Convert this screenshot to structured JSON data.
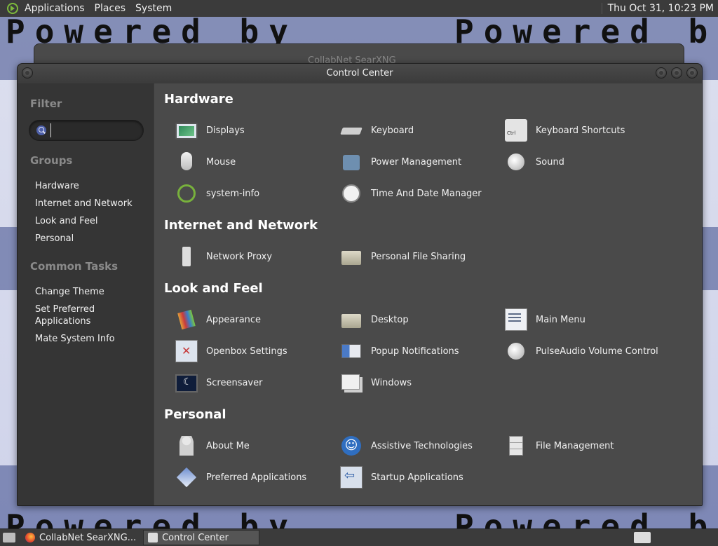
{
  "top_panel": {
    "menus": [
      "Applications",
      "Places",
      "System"
    ],
    "clock": "Thu Oct 31, 10:23 PM"
  },
  "desktop": {
    "wallpaper_text": "Powered by"
  },
  "background_window": {
    "title": "CollabNet SearXNG"
  },
  "window": {
    "title": "Control Center"
  },
  "sidebar": {
    "filter_heading": "Filter",
    "filter_value": "",
    "groups_heading": "Groups",
    "groups": [
      "Hardware",
      "Internet and Network",
      "Look and Feel",
      "Personal"
    ],
    "tasks_heading": "Common Tasks",
    "tasks": [
      "Change Theme",
      "Set Preferred Applications",
      "Mate System Info"
    ]
  },
  "sections": [
    {
      "title": "Hardware",
      "items": [
        {
          "label": "Displays",
          "icon": "display-icon"
        },
        {
          "label": "Keyboard",
          "icon": "keyboard-icon"
        },
        {
          "label": "Keyboard Shortcuts",
          "icon": "keyboard-shortcuts-icon"
        },
        {
          "label": "Mouse",
          "icon": "mouse-icon"
        },
        {
          "label": "Power Management",
          "icon": "power-management-icon"
        },
        {
          "label": "Sound",
          "icon": "sound-icon"
        },
        {
          "label": "system-info",
          "icon": "system-info-icon"
        },
        {
          "label": "Time And Date Manager",
          "icon": "clock-icon"
        }
      ]
    },
    {
      "title": "Internet and Network",
      "items": [
        {
          "label": "Network Proxy",
          "icon": "network-proxy-icon"
        },
        {
          "label": "Personal File Sharing",
          "icon": "folder-share-icon"
        }
      ]
    },
    {
      "title": "Look and Feel",
      "items": [
        {
          "label": "Appearance",
          "icon": "appearance-icon"
        },
        {
          "label": "Desktop",
          "icon": "desktop-folder-icon"
        },
        {
          "label": "Main Menu",
          "icon": "main-menu-icon"
        },
        {
          "label": "Openbox Settings",
          "icon": "openbox-icon"
        },
        {
          "label": "Popup Notifications",
          "icon": "popup-notifications-icon"
        },
        {
          "label": "PulseAudio Volume Control",
          "icon": "pulseaudio-icon"
        },
        {
          "label": "Screensaver",
          "icon": "screensaver-icon"
        },
        {
          "label": "Windows",
          "icon": "windows-icon"
        }
      ]
    },
    {
      "title": "Personal",
      "items": [
        {
          "label": "About Me",
          "icon": "about-me-icon"
        },
        {
          "label": "Assistive Technologies",
          "icon": "accessibility-icon"
        },
        {
          "label": "File Management",
          "icon": "file-management-icon"
        },
        {
          "label": "Preferred Applications",
          "icon": "preferred-applications-icon"
        },
        {
          "label": "Startup Applications",
          "icon": "startup-applications-icon"
        }
      ]
    }
  ],
  "taskbar": {
    "tasks": [
      {
        "label": "CollabNet SearXNG...",
        "icon": "firefox-icon",
        "active": false
      },
      {
        "label": "Control Center",
        "icon": "control-center-icon",
        "active": true
      }
    ]
  }
}
